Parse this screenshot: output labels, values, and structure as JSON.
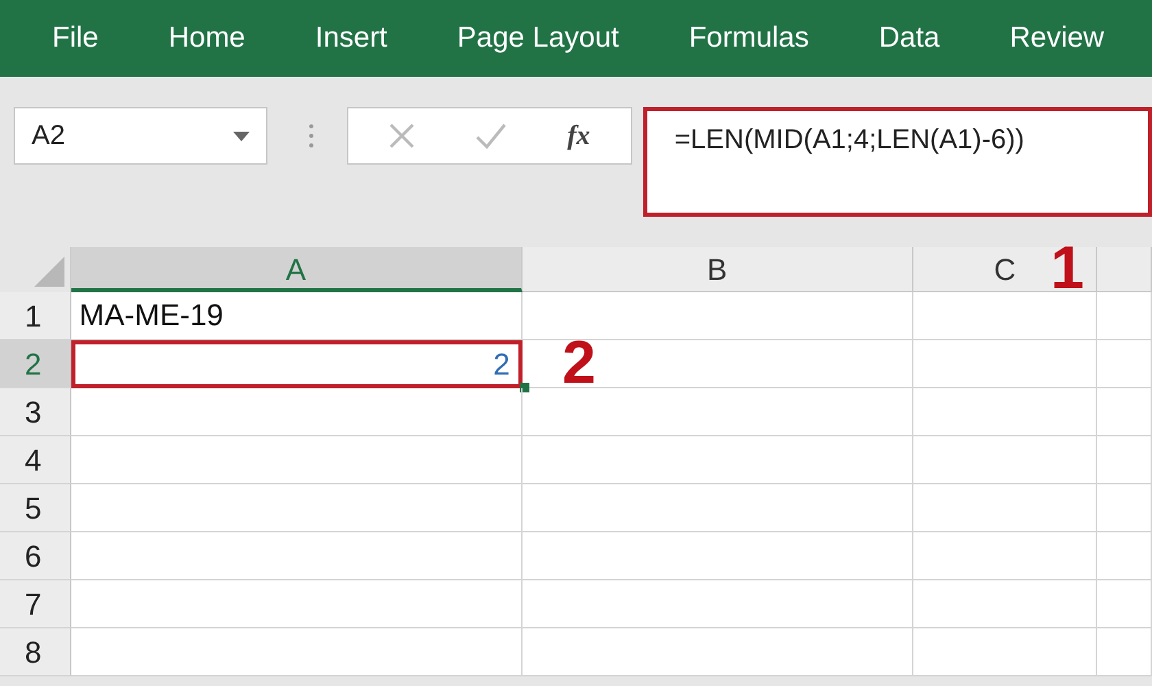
{
  "ribbon_tabs": [
    {
      "label": "File"
    },
    {
      "label": "Home"
    },
    {
      "label": "Insert"
    },
    {
      "label": "Page Layout"
    },
    {
      "label": "Formulas"
    },
    {
      "label": "Data"
    },
    {
      "label": "Review"
    }
  ],
  "name_box": {
    "value": "A2"
  },
  "formula_bar": {
    "fx": "fx",
    "value": "=LEN(MID(A1;4;LEN(A1)-6))",
    "highlighted": true
  },
  "columns": [
    {
      "label": "A",
      "selected": true
    },
    {
      "label": "B",
      "selected": false
    },
    {
      "label": "C",
      "selected": false
    }
  ],
  "rows": [
    {
      "header": "1",
      "selected": false,
      "cells": [
        {
          "text": "MA-ME-19",
          "kind": "text",
          "highlighted": false
        }
      ]
    },
    {
      "header": "2",
      "selected": true,
      "cells": [
        {
          "text": "2",
          "kind": "number",
          "highlighted": true
        }
      ]
    },
    {
      "header": "3",
      "selected": false
    },
    {
      "header": "4",
      "selected": false
    },
    {
      "header": "5",
      "selected": false
    },
    {
      "header": "6",
      "selected": false
    },
    {
      "header": "7",
      "selected": false
    },
    {
      "header": "8",
      "selected": false
    }
  ],
  "annotations": [
    {
      "label": "1"
    },
    {
      "label": "2"
    }
  ]
}
